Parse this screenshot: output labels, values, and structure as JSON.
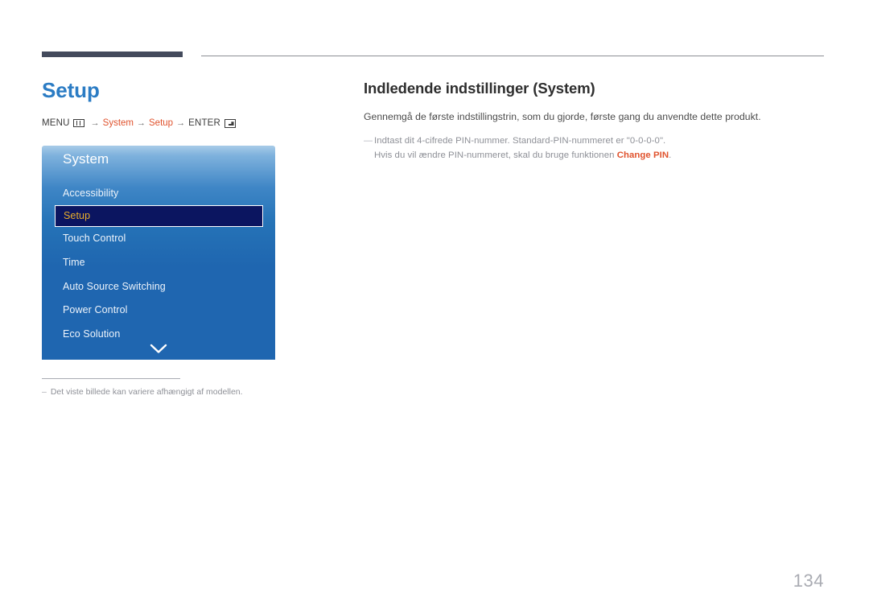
{
  "page": {
    "title": "Setup",
    "number": "134"
  },
  "breadcrumb": {
    "menu_label": "MENU",
    "menu_icon": "remote-menu-icon",
    "arrow": "→",
    "item1": "System",
    "item2": "Setup",
    "enter_label": "ENTER",
    "enter_icon": "enter-key-icon",
    "accent_color": "#e0532e"
  },
  "osd": {
    "title": "System",
    "items": [
      {
        "label": "Accessibility",
        "selected": false
      },
      {
        "label": "Setup",
        "selected": true
      },
      {
        "label": "Touch Control",
        "selected": false
      },
      {
        "label": "Time",
        "selected": false
      },
      {
        "label": "Auto Source Switching",
        "selected": false
      },
      {
        "label": "Power Control",
        "selected": false
      },
      {
        "label": "Eco Solution",
        "selected": false
      }
    ],
    "scroll_icon": "chevron-down-icon",
    "selected_text_color": "#e8ad2b",
    "selected_bg_color": "#0b1560",
    "panel_color": "#1f66b0"
  },
  "left_note": {
    "dash": "–",
    "text": "Det viste billede kan variere afhængigt af modellen."
  },
  "content": {
    "heading": "Indledende indstillinger (System)",
    "lead": "Gennemgå de første indstillingstrin, som du gjorde, første gang du anvendte dette produkt.",
    "note": {
      "dash": "―",
      "line1": "Indtast dit 4-cifrede PIN-nummer. Standard-PIN-nummeret er \"0-0-0-0\".",
      "line2_before": "Hvis du vil ændre PIN-nummeret, skal du bruge funktionen ",
      "line2_link": "Change PIN",
      "line2_after": "."
    }
  }
}
